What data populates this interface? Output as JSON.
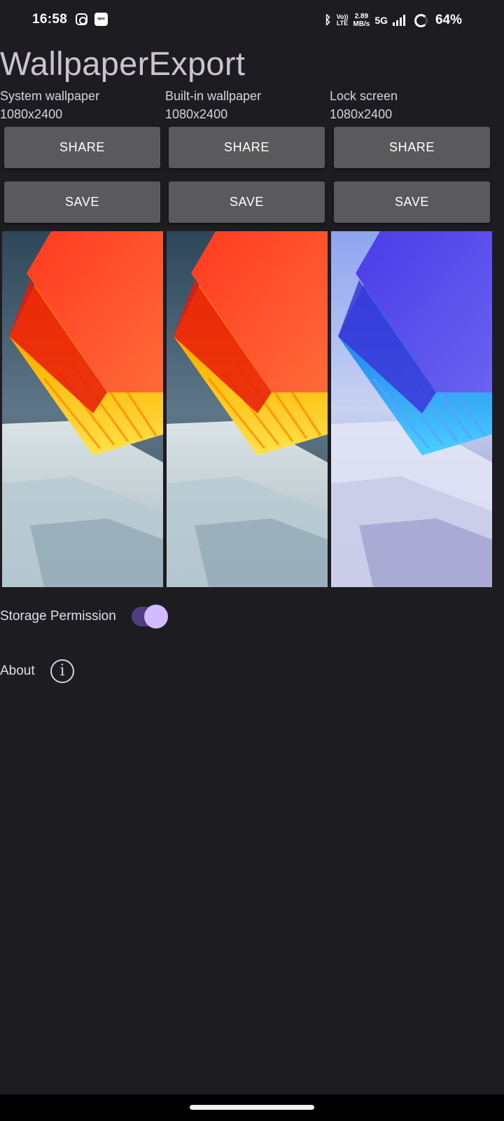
{
  "status_bar": {
    "time": "16:58",
    "icons": [
      "instagram-icon",
      "iqoo-icon",
      "bluetooth-icon",
      "volte-icon",
      "5g-icon",
      "signal-icon",
      "battery-ring-icon"
    ],
    "volte_top": "Vo))",
    "volte_bottom": "LTE",
    "speed_value": "2.89",
    "speed_unit": "MB/s",
    "network": "5G",
    "battery": "64%",
    "iqoo_text": "iqoo"
  },
  "app": {
    "title": "WallpaperExport"
  },
  "wallpapers": [
    {
      "label": "System wallpaper",
      "resolution": "1080x2400",
      "share_label": "SHARE",
      "save_label": "SAVE",
      "theme": "orange"
    },
    {
      "label": "Built-in wallpaper",
      "resolution": "1080x2400",
      "share_label": "SHARE",
      "save_label": "SAVE",
      "theme": "orange"
    },
    {
      "label": "Lock screen",
      "resolution": "1080x2400",
      "share_label": "SHARE",
      "save_label": "SAVE",
      "theme": "blue"
    }
  ],
  "settings": {
    "storage_permission_label": "Storage Permission",
    "storage_permission_enabled": true,
    "about_label": "About"
  },
  "colors": {
    "background": "#1d1c21",
    "button": "#5a5a5d",
    "switch_track": "#4e3d7c",
    "switch_knob": "#d4bbff"
  }
}
